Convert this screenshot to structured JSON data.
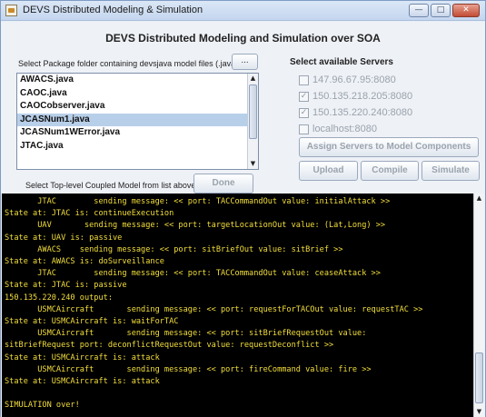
{
  "window": {
    "title": "DEVS Distributed Modeling & Simulation",
    "minimize_glyph": "—",
    "maximize_glyph": "□",
    "close_glyph": "✕"
  },
  "header": {
    "title": "DEVS Distributed Modeling and Simulation over SOA"
  },
  "package": {
    "label": "Select Package folder containing devsjava model files (.java)",
    "browse_label": "...",
    "files": [
      {
        "name": "AWACS.java",
        "selected": false
      },
      {
        "name": "CAOC.java",
        "selected": false
      },
      {
        "name": "CAOCobserver.java",
        "selected": false
      },
      {
        "name": "JCASNum1.java",
        "selected": true
      },
      {
        "name": "JCASNum1WError.java",
        "selected": false
      },
      {
        "name": "JTAC.java",
        "selected": false
      }
    ],
    "hint": "Select Top-level Coupled Model from list above",
    "done_label": "Done"
  },
  "servers": {
    "heading": "Select available Servers",
    "items": [
      {
        "address": "147.96.67.95:8080",
        "checked": false
      },
      {
        "address": "150.135.218.205:8080",
        "checked": true
      },
      {
        "address": "150.135.220.240:8080",
        "checked": true
      },
      {
        "address": "localhost:8080",
        "checked": false
      }
    ],
    "assign_label": "Assign Servers to Model Components",
    "upload_label": "Upload",
    "compile_label": "Compile",
    "simulate_label": "Simulate"
  },
  "console": {
    "lines": [
      "       JTAC        sending message: << port: TACCommandOut value: initialAttack >>",
      "State at: JTAC is: continueExecution",
      "       UAV       sending message: << port: targetLocationOut value: (Lat,Long) >>",
      "State at: UAV is: passive",
      "       AWACS    sending message: << port: sitBriefOut value: sitBrief >>",
      "State at: AWACS is: doSurveillance",
      "       JTAC        sending message: << port: TACCommandOut value: ceaseAttack >>",
      "State at: JTAC is: passive",
      "150.135.220.240 output:",
      "       USMCAircraft       sending message: << port: requestForTACOut value: requestTAC >>",
      "State at: USMCAircraft is: waitForTAC",
      "       USMCAircraft       sending message: << port: sitBriefRequestOut value:",
      "sitBriefRequest port: deconflictRequestOut value: requestDeconflict >>",
      "State at: USMCAircraft is: attack",
      "       USMCAircraft       sending message: << port: fireCommand value: fire >>",
      "State at: USMCAircraft is: attack",
      "",
      "SIMULATION over!"
    ]
  }
}
